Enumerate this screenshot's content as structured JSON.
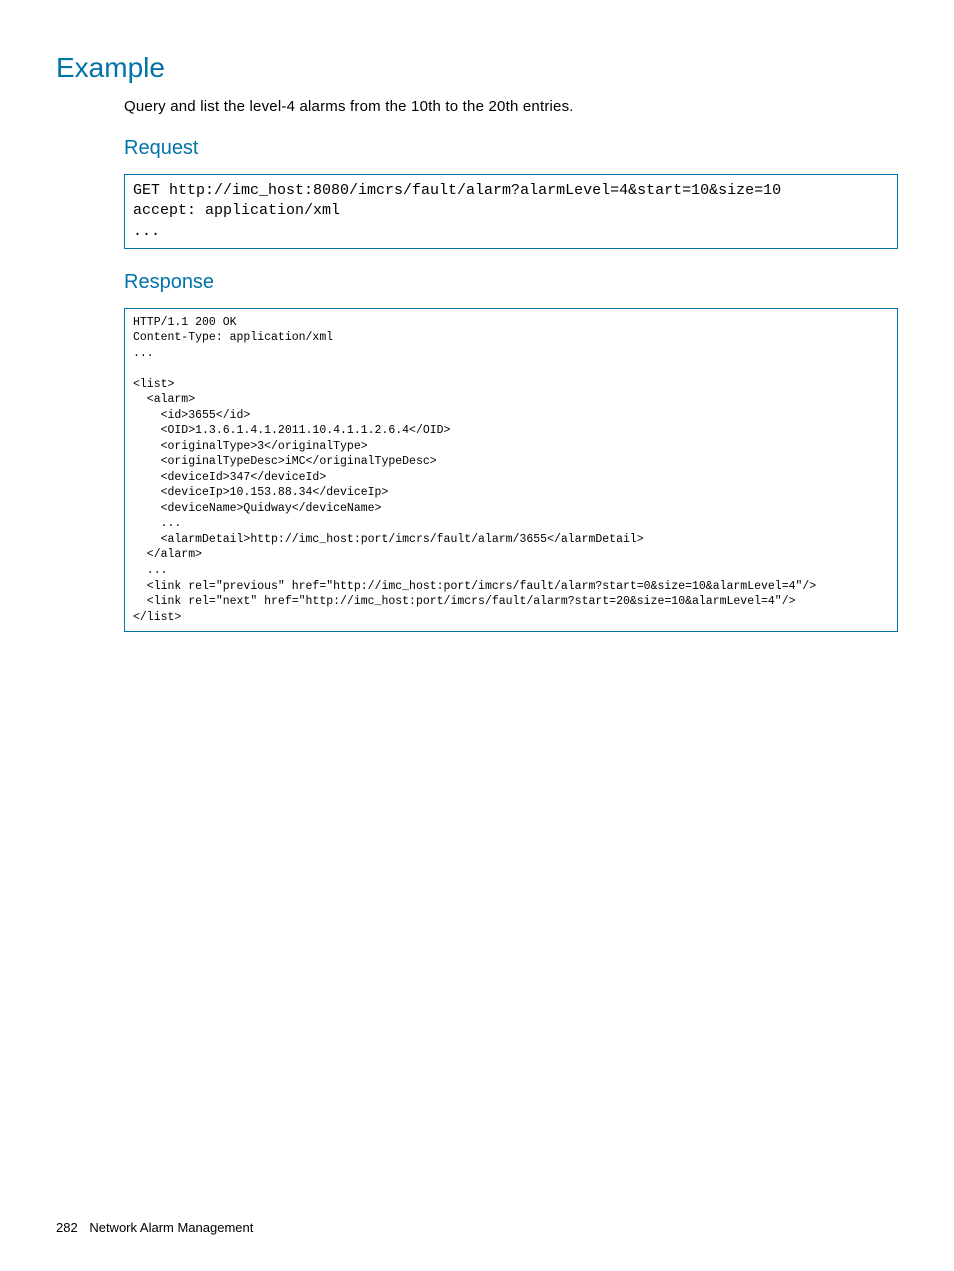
{
  "headings": {
    "example": "Example",
    "request": "Request",
    "response": "Response"
  },
  "intro": "Query and list the level-4 alarms from the 10th to the 20th entries.",
  "request_code": "GET http://imc_host:8080/imcrs/fault/alarm?alarmLevel=4&start=10&size=10\naccept: application/xml\n...",
  "response_code": "HTTP/1.1 200 OK\nContent-Type: application/xml\n...\n\n<list>\n  <alarm>\n    <id>3655</id>\n    <OID>1.3.6.1.4.1.2011.10.4.1.1.2.6.4</OID>\n    <originalType>3</originalType>\n    <originalTypeDesc>iMC</originalTypeDesc>\n    <deviceId>347</deviceId>\n    <deviceIp>10.153.88.34</deviceIp>\n    <deviceName>Quidway</deviceName>\n    ...\n    <alarmDetail>http://imc_host:port/imcrs/fault/alarm/3655</alarmDetail>\n  </alarm>\n  ...\n  <link rel=\"previous\" href=\"http://imc_host:port/imcrs/fault/alarm?start=0&size=10&alarmLevel=4\"/>\n  <link rel=\"next\" href=\"http://imc_host:port/imcrs/fault/alarm?start=20&size=10&alarmLevel=4\"/>\n</list>",
  "footer": {
    "page_number": "282",
    "section_title": "Network Alarm Management"
  }
}
